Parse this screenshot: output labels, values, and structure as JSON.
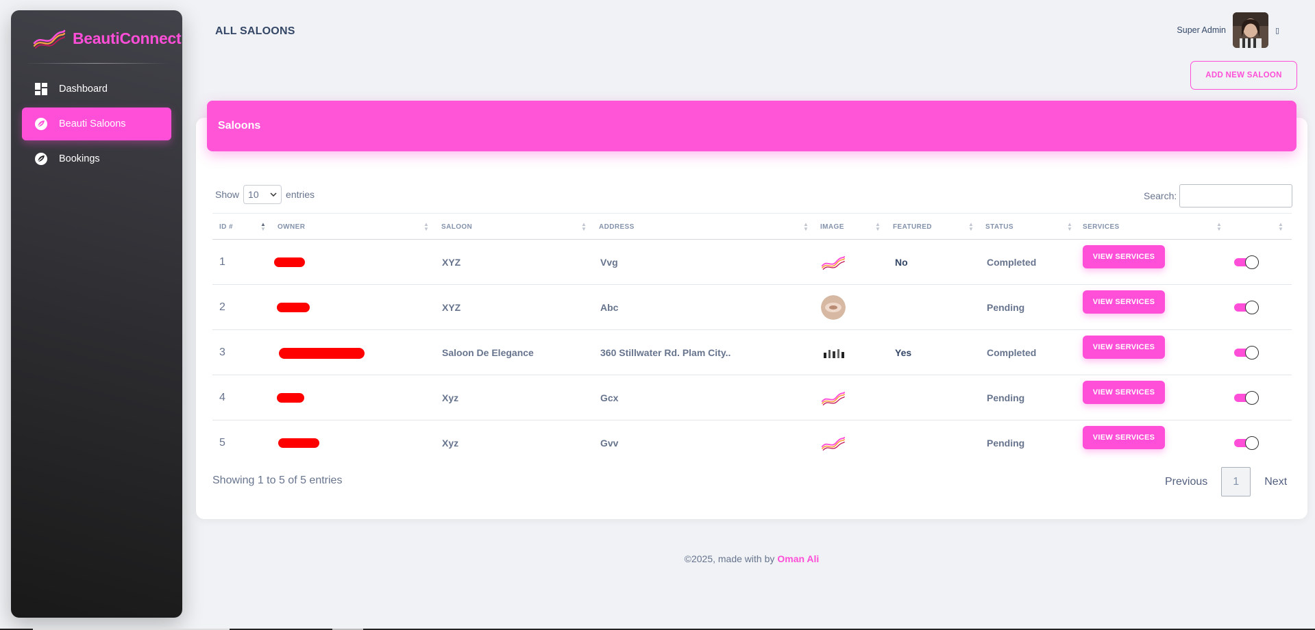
{
  "brand": {
    "name": "BeautiConnect"
  },
  "sidebar": {
    "items": [
      {
        "label": "Dashboard",
        "icon": "dashboard-icon",
        "active": false
      },
      {
        "label": "Beauti Saloons",
        "icon": "leaf-icon",
        "active": true
      },
      {
        "label": "Bookings",
        "icon": "leaf-icon",
        "active": false
      }
    ]
  },
  "header": {
    "title": "ALL SALOONS",
    "user_name": "Super Admin",
    "caret": "▯"
  },
  "actions": {
    "add_label": "ADD NEW SALOON"
  },
  "card": {
    "title": "Saloons"
  },
  "table_controls": {
    "show_label": "Show",
    "entries_value": "10",
    "entries_label": "entries",
    "search_label": "Search:"
  },
  "table": {
    "headers": [
      "ID #",
      "OWNER",
      "SALOON",
      "ADDRESS",
      "IMAGE",
      "FEATURED",
      "STATUS",
      "SERVICES",
      ""
    ],
    "rows": [
      {
        "id": "1",
        "saloon": "XYZ",
        "address": "Vvg",
        "image": "brand-logo",
        "featured": "No",
        "status": "Completed",
        "service_label": "VIEW SERVICES",
        "enabled": true
      },
      {
        "id": "2",
        "saloon": "XYZ",
        "address": "Abc",
        "image": "photo",
        "featured": "",
        "status": "Pending",
        "service_label": "VIEW SERVICES",
        "enabled": true
      },
      {
        "id": "3",
        "saloon": "Saloon De Elegance",
        "address": "360 Stillwater Rd. Plam City..",
        "image": "salon-interior",
        "featured": "Yes",
        "status": "Completed",
        "service_label": "VIEW SERVICES",
        "enabled": true
      },
      {
        "id": "4",
        "saloon": "Xyz",
        "address": "Gcx",
        "image": "brand-logo",
        "featured": "",
        "status": "Pending",
        "service_label": "VIEW SERVICES",
        "enabled": true
      },
      {
        "id": "5",
        "saloon": "Xyz",
        "address": "Gvv",
        "image": "brand-logo",
        "featured": "",
        "status": "Pending",
        "service_label": "VIEW SERVICES",
        "enabled": true
      }
    ]
  },
  "pagination": {
    "summary": "Showing 1 to 5 of 5 entries",
    "previous": "Previous",
    "current": "1",
    "next": "Next"
  },
  "footer": {
    "text": "©2025, made with by",
    "author": "Oman Ali"
  },
  "colors": {
    "accent": "#ff4fd8",
    "sidebar_dark": "#191919",
    "text": "#344767",
    "muted": "#67748e"
  }
}
